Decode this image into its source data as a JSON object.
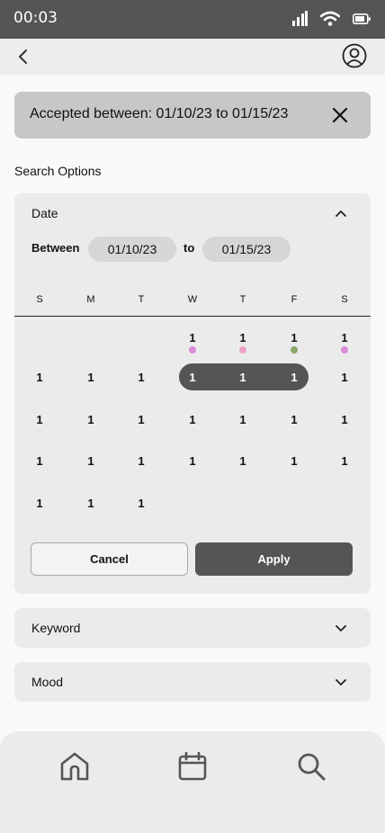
{
  "status_bar": {
    "time": "00:03"
  },
  "topbar": {
    "back_icon": "chevron-left-icon",
    "profile_icon": "user-circle-icon"
  },
  "filter_chip": {
    "text": "Accepted between: 01/10/23 to 01/15/23",
    "close_icon": "close-icon"
  },
  "search_options_label": "Search Options",
  "date_panel": {
    "title": "Date",
    "between_label": "Between",
    "from_value": "01/10/23",
    "to_label": "to",
    "to_value": "01/15/23",
    "weekdays": [
      "S",
      "M",
      "T",
      "W",
      "T",
      "F",
      "S"
    ],
    "weeks": [
      [
        "",
        "",
        "",
        "1",
        "1",
        "1",
        "1"
      ],
      [
        "1",
        "1",
        "1",
        "1",
        "1",
        "1",
        "1"
      ],
      [
        "1",
        "1",
        "1",
        "1",
        "1",
        "1",
        "1"
      ],
      [
        "1",
        "1",
        "1",
        "1",
        "1",
        "1",
        "1"
      ],
      [
        "1",
        "1",
        "1",
        "",
        "",
        "",
        ""
      ]
    ],
    "selected": {
      "week": 1,
      "from_day": 3,
      "to_day": 5
    },
    "mood_dots": [
      {
        "week": 0,
        "day": 3,
        "color": "#d98ad9"
      },
      {
        "week": 0,
        "day": 4,
        "color": "#f0a0c8"
      },
      {
        "week": 0,
        "day": 5,
        "color": "#8aa86a"
      },
      {
        "week": 0,
        "day": 6,
        "color": "#d98ad9"
      }
    ],
    "cancel_label": "Cancel",
    "apply_label": "Apply"
  },
  "keyword_panel": {
    "title": "Keyword"
  },
  "mood_panel": {
    "title": "Mood"
  },
  "bottom_nav": {
    "items": [
      "home-icon",
      "calendar-icon",
      "search-icon"
    ]
  }
}
